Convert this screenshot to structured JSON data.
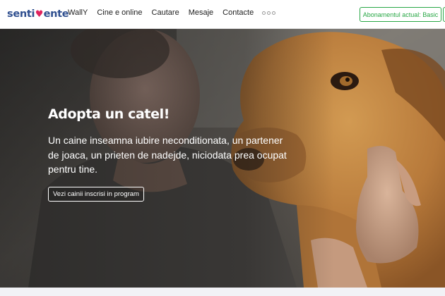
{
  "header": {
    "logo": {
      "part1": "senti",
      "heart": "♥",
      "part2": "ente"
    },
    "nav": [
      {
        "label": "WallY"
      },
      {
        "label": "Cine e online"
      },
      {
        "label": "Cautare"
      },
      {
        "label": "Mesaje"
      },
      {
        "label": "Contacte"
      }
    ],
    "more_icon": "more-dots-icon",
    "plan_button_label": "Abonamentul actual: Basic"
  },
  "hero": {
    "title": "Adopta un catel!",
    "text": "Un caine inseamna iubire neconditionata, un partener de joaca, un prieten de nadejde, niciodata prea ocupat pentru tine.",
    "button_label": "Vezi cainii inscrisi in program",
    "image": "man-with-dog-photo"
  },
  "colors": {
    "brand": "#2f4f8f",
    "heart": "#e0245e",
    "accent_green": "#28a745"
  }
}
